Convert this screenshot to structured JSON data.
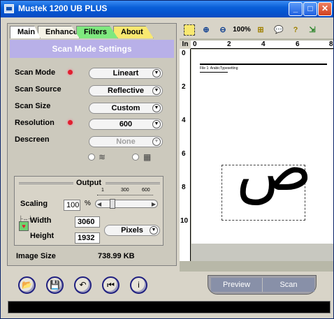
{
  "window": {
    "title": "Mustek 1200 UB PLUS"
  },
  "tabs": [
    "Main",
    "Enhance",
    "Filters",
    "About"
  ],
  "section_title": "Scan Mode Settings",
  "settings": {
    "scan_mode": {
      "label": "Scan Mode",
      "value": "Lineart"
    },
    "scan_source": {
      "label": "Scan Source",
      "value": "Reflective"
    },
    "scan_size": {
      "label": "Scan Size",
      "value": "Custom"
    },
    "resolution": {
      "label": "Resolution",
      "value": "600"
    },
    "descreen": {
      "label": "Descreen",
      "value": "None"
    }
  },
  "output": {
    "title": "Output",
    "scaling_label": "Scaling",
    "scaling_value": "100",
    "scaling_unit": "%",
    "slider_ticks": [
      "1",
      "300",
      "600"
    ],
    "width_label": "Width",
    "width_value": "3060",
    "height_label": "Height",
    "height_value": "1932",
    "unit_value": "Pixels"
  },
  "image_size": {
    "label": "Image Size",
    "value": "738.99 KB"
  },
  "toolbar": {
    "zoom_level": "100%"
  },
  "ruler": {
    "unit": "In",
    "h_ticks": [
      "0",
      "2",
      "4",
      "6",
      "8"
    ],
    "v_ticks": [
      "0",
      "2",
      "4",
      "6",
      "8",
      "10"
    ]
  },
  "preview": {
    "glyph": "ص",
    "doc_text": "File 1: ArabicTypesetting"
  },
  "buttons": {
    "preview": "Preview",
    "scan": "Scan"
  },
  "colors": {
    "title_bar": "#0a5fd8",
    "section_header": "#b8b0e8",
    "filters_tab": "#7fe87f",
    "about_tab": "#f8e870"
  }
}
